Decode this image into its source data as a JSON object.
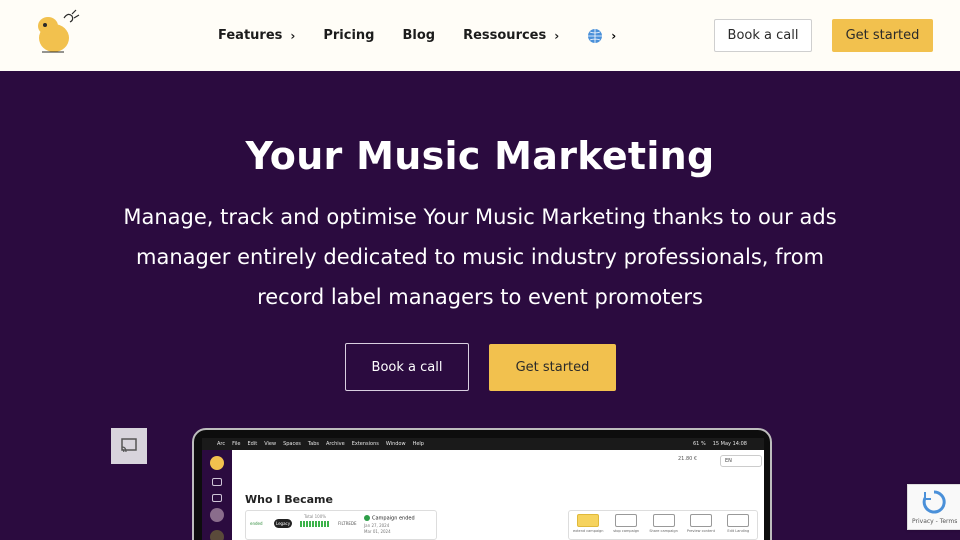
{
  "header": {
    "nav": [
      {
        "label": "Features",
        "has_chevron": true
      },
      {
        "label": "Pricing",
        "has_chevron": false
      },
      {
        "label": "Blog",
        "has_chevron": false
      },
      {
        "label": "Ressources",
        "has_chevron": true
      }
    ],
    "language_icon": "globe-icon",
    "book_call_label": "Book a call",
    "get_started_label": "Get started"
  },
  "hero": {
    "title": "Your Music Marketing",
    "subtitle": "Manage, track and optimise Your Music Marketing thanks to our ads manager entirely dedicated to music industry professionals, from record label managers to event promoters",
    "book_call_label": "Book a call",
    "get_started_label": "Get started"
  },
  "colors": {
    "hero_background": "#2b0b3f",
    "header_background": "#fffdf7",
    "accent": "#f2c14e"
  },
  "mockup": {
    "menubar": [
      "Arc",
      "File",
      "Edit",
      "View",
      "Spaces",
      "Tabs",
      "Archive",
      "Extensions",
      "Window",
      "Help"
    ],
    "menubar_clock": "15 May 14:08",
    "battery": "61 %",
    "balance": "21.80 €",
    "language": "EN",
    "app_title": "Who I Became",
    "campaign": {
      "status_green": "ended",
      "pill": "Legacy",
      "bar_caption": "Total 100%",
      "network": "FILTREDE",
      "status": "Campaign ended",
      "start_date": "Jan 27, 2024",
      "end_date": "Mar 01, 2024"
    },
    "actions": [
      "extend campaign",
      "stop campaign",
      "Share campaign",
      "Preview content",
      "Edit Landing"
    ]
  },
  "recaptcha": {
    "terms": "Privacy - Terms"
  }
}
